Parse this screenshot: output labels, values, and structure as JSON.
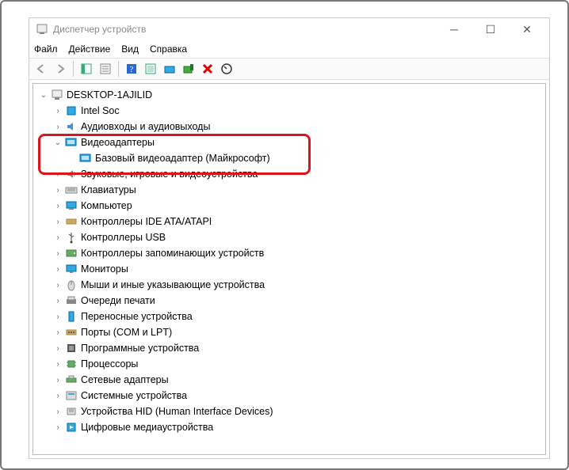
{
  "window": {
    "title": "Диспетчер устройств"
  },
  "menubar": {
    "file": "Файл",
    "action": "Действие",
    "view": "Вид",
    "help": "Справка"
  },
  "tree": {
    "root": "DESKTOP-1AJILID",
    "items": {
      "intelSoc": "Intel Soc",
      "audio": "Аудиовходы и аудиовыходы",
      "video": "Видеоадаптеры",
      "videoChild": "Базовый видеоадаптер (Майкрософт)",
      "sound": "Звуковые, игровые и видеоустройства",
      "keyboards": "Клавиатуры",
      "computer": "Компьютер",
      "ide": "Контроллеры IDE ATA/ATAPI",
      "usb": "Контроллеры USB",
      "storageCtrl": "Контроллеры запоминающих устройств",
      "monitors": "Мониторы",
      "mice": "Мыши и иные указывающие устройства",
      "printQueues": "Очереди печати",
      "portable": "Переносные устройства",
      "ports": "Порты (COM и LPT)",
      "software": "Программные устройства",
      "cpu": "Процессоры",
      "net": "Сетевые адаптеры",
      "system": "Системные устройства",
      "hid": "Устройства HID (Human Interface Devices)",
      "digitalMedia": "Цифровые медиаустройства"
    }
  }
}
